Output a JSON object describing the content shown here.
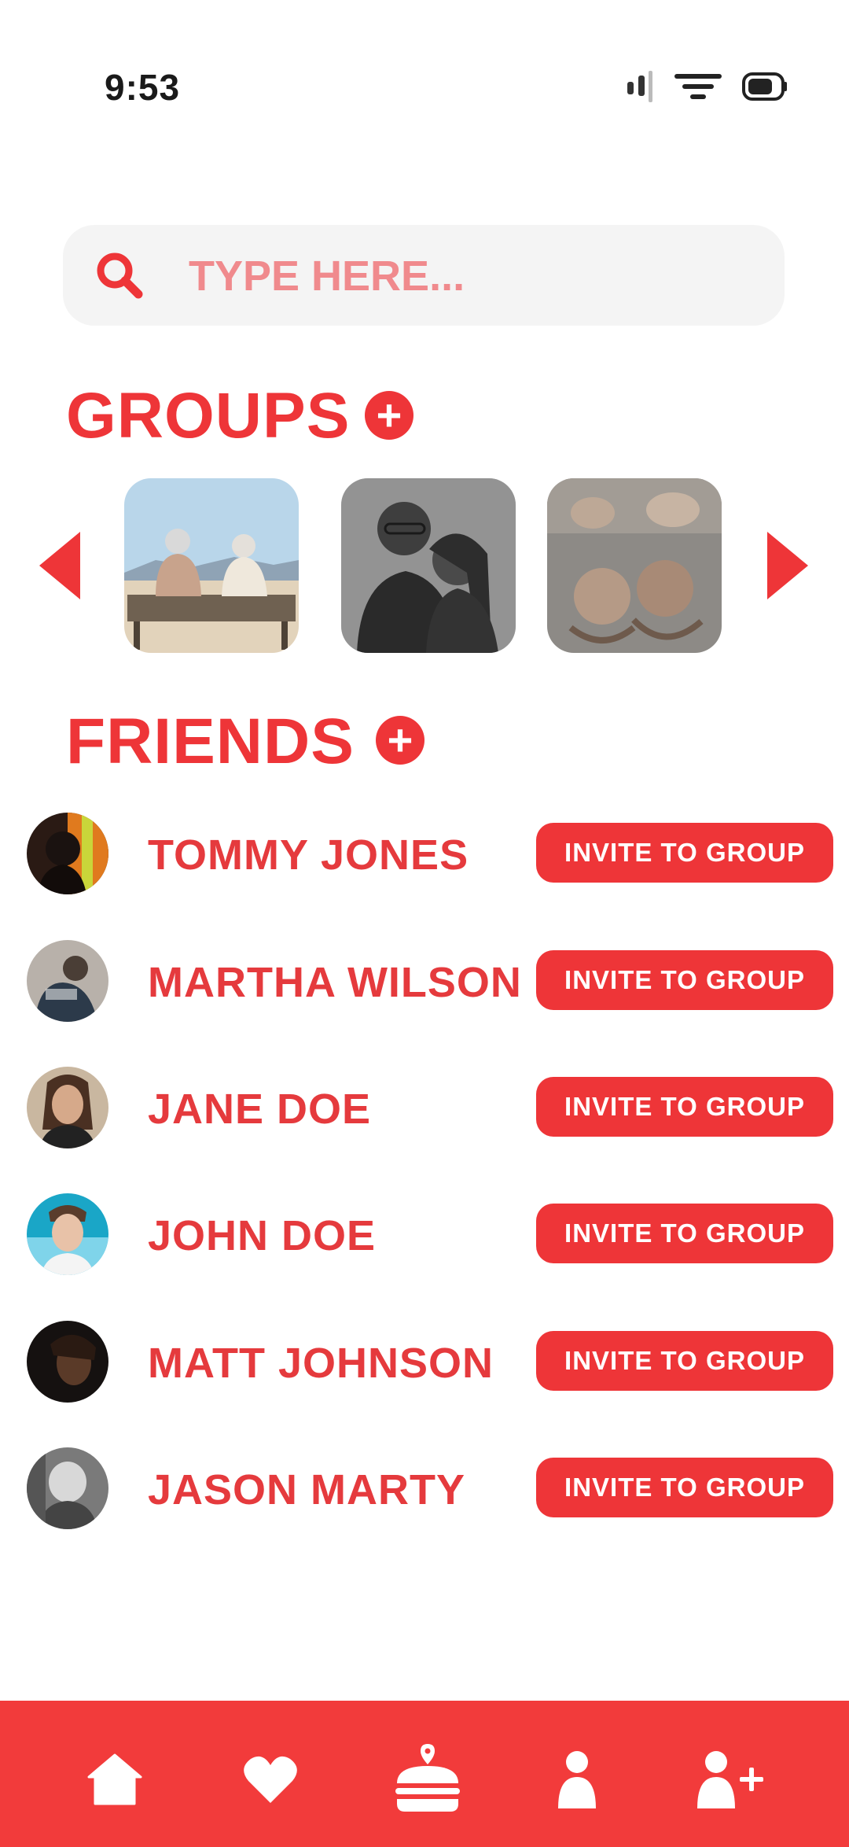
{
  "status_bar": {
    "time": "9:53"
  },
  "search": {
    "placeholder": "TYPE HERE..."
  },
  "groups": {
    "title": "GROUPS",
    "tiles": [
      {
        "name": "group-photo-elderly-couple"
      },
      {
        "name": "group-photo-couple-bw"
      },
      {
        "name": "group-photo-friends"
      }
    ]
  },
  "friends": {
    "title": "FRIENDS",
    "items": [
      {
        "name": "TOMMY JONES",
        "action": "INVITE TO GROUP"
      },
      {
        "name": "MARTHA WILSON",
        "action": "INVITE TO GROUP"
      },
      {
        "name": "JANE DOE",
        "action": "INVITE TO GROUP"
      },
      {
        "name": "JOHN DOE",
        "action": "INVITE TO GROUP"
      },
      {
        "name": "MATT JOHNSON",
        "action": "INVITE TO GROUP"
      },
      {
        "name": "JASON MARTY",
        "action": "INVITE TO GROUP"
      }
    ]
  },
  "bottom_nav": {
    "icons": [
      "home-icon",
      "heart-icon",
      "burger-location-icon",
      "profile-icon",
      "add-friend-icon"
    ]
  },
  "colors": {
    "accent": "#ee3538",
    "nav_bg": "#f23b3b",
    "search_bg": "#f4f4f4",
    "placeholder": "#f08a8d"
  }
}
